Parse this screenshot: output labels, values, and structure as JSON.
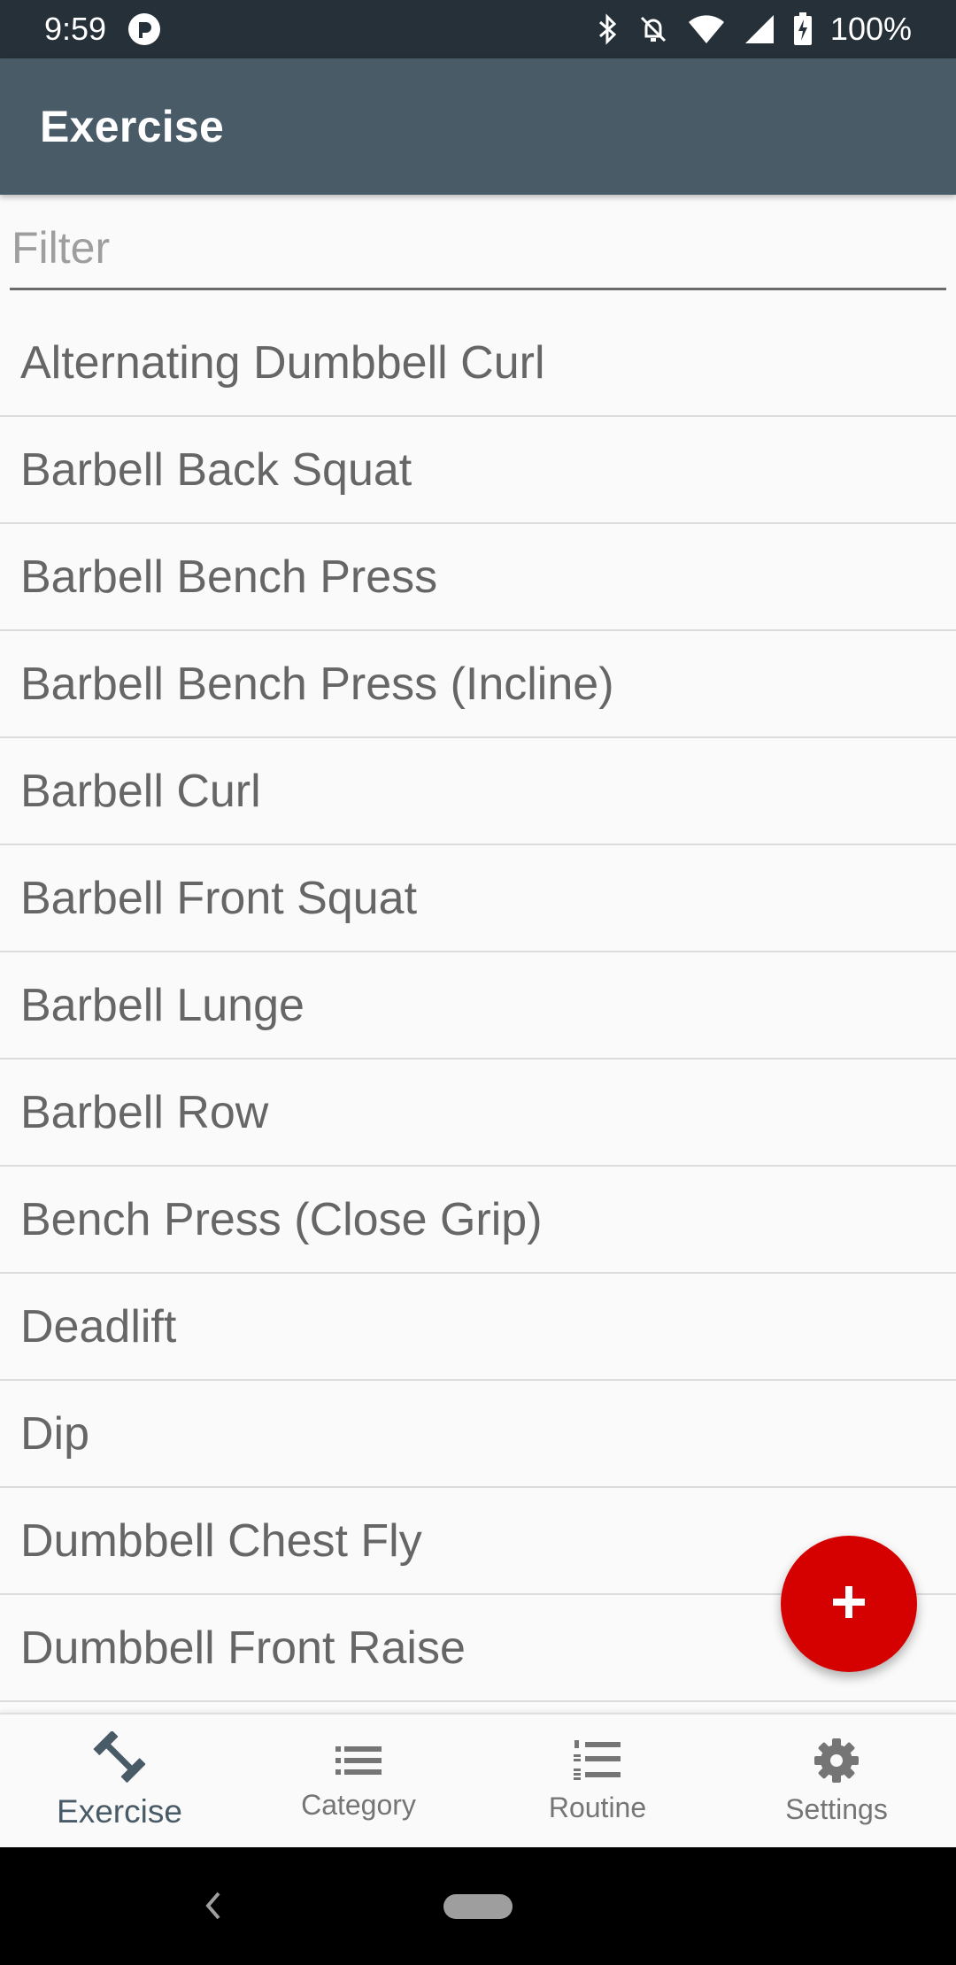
{
  "status_bar": {
    "time": "9:59",
    "battery": "100%",
    "icons": [
      "notification-app-icon",
      "bluetooth-icon",
      "do-not-disturb-icon",
      "wifi-icon",
      "signal-icon",
      "battery-charging-icon"
    ]
  },
  "app_bar": {
    "title": "Exercise"
  },
  "filter": {
    "placeholder": "Filter",
    "value": ""
  },
  "exercises": [
    "Alternating Dumbbell Curl",
    "Barbell Back Squat",
    "Barbell Bench Press",
    "Barbell Bench Press (Incline)",
    "Barbell Curl",
    "Barbell Front Squat",
    "Barbell Lunge",
    "Barbell Row",
    "Bench Press (Close Grip)",
    "Deadlift",
    "Dip",
    "Dumbbell Chest Fly",
    "Dumbbell Front Raise"
  ],
  "fab": {
    "icon": "plus-icon"
  },
  "bottom_nav": {
    "active": "Exercise",
    "items": [
      {
        "label": "Exercise",
        "icon": "dumbbell-icon"
      },
      {
        "label": "Category",
        "icon": "list-icon"
      },
      {
        "label": "Routine",
        "icon": "numbered-list-icon"
      },
      {
        "label": "Settings",
        "icon": "gear-icon"
      }
    ]
  },
  "colors": {
    "status_bar": "#263039",
    "app_bar": "#4a5b68",
    "fab": "#d50000",
    "text": "#666666"
  }
}
